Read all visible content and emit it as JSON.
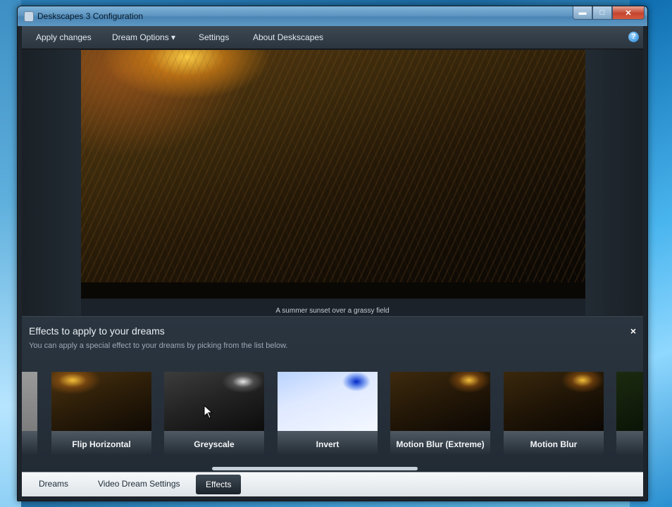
{
  "window": {
    "title": "Deskscapes 3 Configuration"
  },
  "title_buttons": {
    "minimize": "▬",
    "maximize": "□",
    "close": "✕"
  },
  "menu": {
    "items": [
      "Apply changes",
      "Dream Options ▾",
      "Settings",
      "About Deskscapes"
    ],
    "help": "?"
  },
  "preview": {
    "caption": "A summer sunset over a grassy field"
  },
  "effects": {
    "title": "Effects to apply to your dreams",
    "subtitle": "You can apply a special effect to your dreams by picking from the list below.",
    "close": "×",
    "items": [
      {
        "label": "Flip Horizontal"
      },
      {
        "label": "Greyscale"
      },
      {
        "label": "Invert"
      },
      {
        "label": "Motion Blur (Extreme)"
      },
      {
        "label": "Motion Blur"
      }
    ]
  },
  "tabs": [
    "Dreams",
    "Video Dream Settings",
    "Effects"
  ]
}
